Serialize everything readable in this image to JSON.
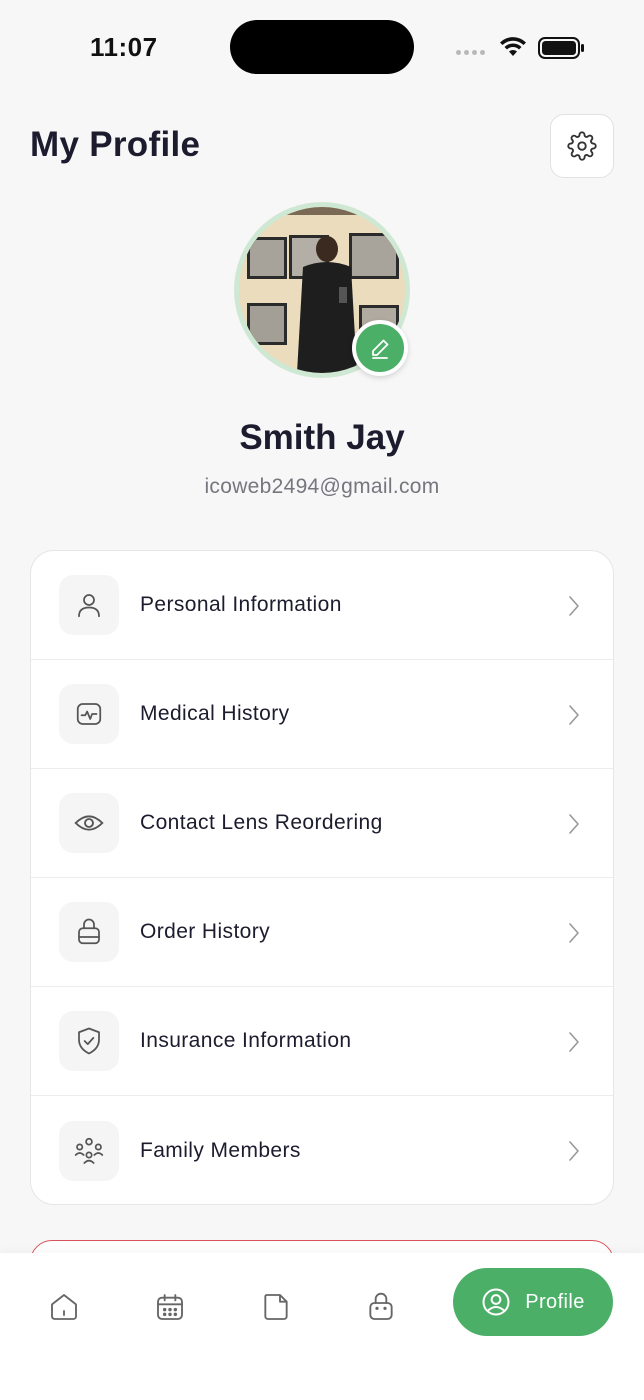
{
  "status_bar": {
    "time": "11:07"
  },
  "header": {
    "title": "My Profile",
    "settings_icon": "gear-icon"
  },
  "profile": {
    "name": "Smith Jay",
    "email": "icoweb2494@gmail.com",
    "edit_icon": "pencil-icon"
  },
  "menu": {
    "items": [
      {
        "label": "Personal Information",
        "icon": "user-icon"
      },
      {
        "label": "Medical History",
        "icon": "heart-monitor-icon"
      },
      {
        "label": "Contact Lens Reordering",
        "icon": "eye-icon"
      },
      {
        "label": "Order History",
        "icon": "shopping-bag-icon"
      },
      {
        "label": "Insurance Information",
        "icon": "shield-check-icon"
      },
      {
        "label": "Family Members",
        "icon": "family-icon"
      }
    ]
  },
  "bottom_nav": {
    "items": [
      {
        "icon": "home-icon"
      },
      {
        "icon": "calendar-icon"
      },
      {
        "icon": "document-icon"
      },
      {
        "icon": "bag-icon"
      }
    ],
    "active": {
      "label": "Profile",
      "icon": "profile-circle-icon"
    }
  },
  "colors": {
    "accent": "#4caf67",
    "background": "#f7f7f7",
    "text": "#1c1c2e",
    "muted": "#76767e",
    "danger": "#d9545a"
  }
}
